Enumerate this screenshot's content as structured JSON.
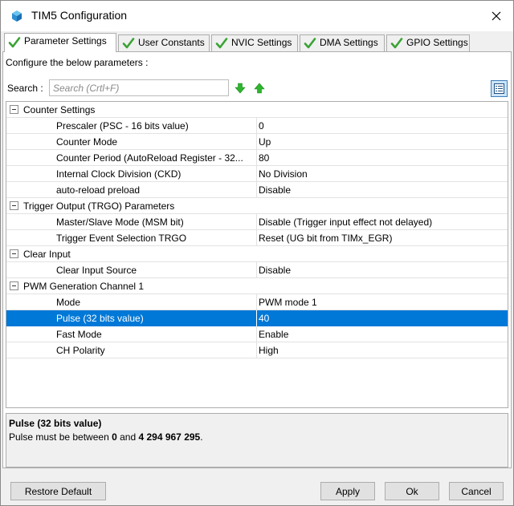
{
  "window": {
    "title": "TIM5 Configuration"
  },
  "tabs": [
    {
      "label": "Parameter Settings",
      "active": true
    },
    {
      "label": "User Constants",
      "active": false
    },
    {
      "label": "NVIC Settings",
      "active": false
    },
    {
      "label": "DMA Settings",
      "active": false
    },
    {
      "label": "GPIO Settings",
      "active": false
    }
  ],
  "config_label": "Configure the below parameters :",
  "search": {
    "label": "Search :",
    "placeholder": "Search (Crtl+F)"
  },
  "groups": [
    {
      "label": "Counter Settings",
      "params": [
        {
          "name": "Prescaler (PSC - 16 bits value)",
          "value": "0"
        },
        {
          "name": "Counter Mode",
          "value": "Up"
        },
        {
          "name": "Counter Period (AutoReload Register - 32...",
          "value": "80"
        },
        {
          "name": "Internal Clock Division (CKD)",
          "value": "No Division"
        },
        {
          "name": "auto-reload preload",
          "value": "Disable"
        }
      ]
    },
    {
      "label": "Trigger Output (TRGO) Parameters",
      "params": [
        {
          "name": "Master/Slave Mode (MSM bit)",
          "value": "Disable (Trigger input effect not delayed)"
        },
        {
          "name": "Trigger Event Selection TRGO",
          "value": "Reset (UG bit from TIMx_EGR)"
        }
      ]
    },
    {
      "label": "Clear Input",
      "params": [
        {
          "name": "Clear Input Source",
          "value": "Disable"
        }
      ]
    },
    {
      "label": "PWM Generation Channel 1",
      "params": [
        {
          "name": "Mode",
          "value": "PWM mode 1"
        },
        {
          "name": "Pulse (32 bits value)",
          "value": "40"
        },
        {
          "name": "Fast Mode",
          "value": "Enable"
        },
        {
          "name": "CH Polarity",
          "value": "High"
        }
      ]
    }
  ],
  "selected_param": "Pulse (32 bits value)",
  "description": {
    "title": "Pulse (32 bits value)",
    "text_before": "Pulse must be between ",
    "min": "0",
    "text_middle": " and ",
    "max": "4 294 967 295",
    "text_after": "."
  },
  "buttons": {
    "restore_default": "Restore Default",
    "apply": "Apply",
    "ok": "Ok",
    "cancel": "Cancel"
  },
  "colors": {
    "selection": "#0078d7",
    "check_green": "#3aa335",
    "arrow_green": "#2db52d"
  },
  "icons": {
    "app": "cube-icon",
    "tab_status": "green-check-icon",
    "search_next": "arrow-down-icon",
    "search_prev": "arrow-up-icon",
    "view_toggle": "list-view-icon",
    "close": "close-icon",
    "group_toggle": "collapse-minus-icon"
  }
}
